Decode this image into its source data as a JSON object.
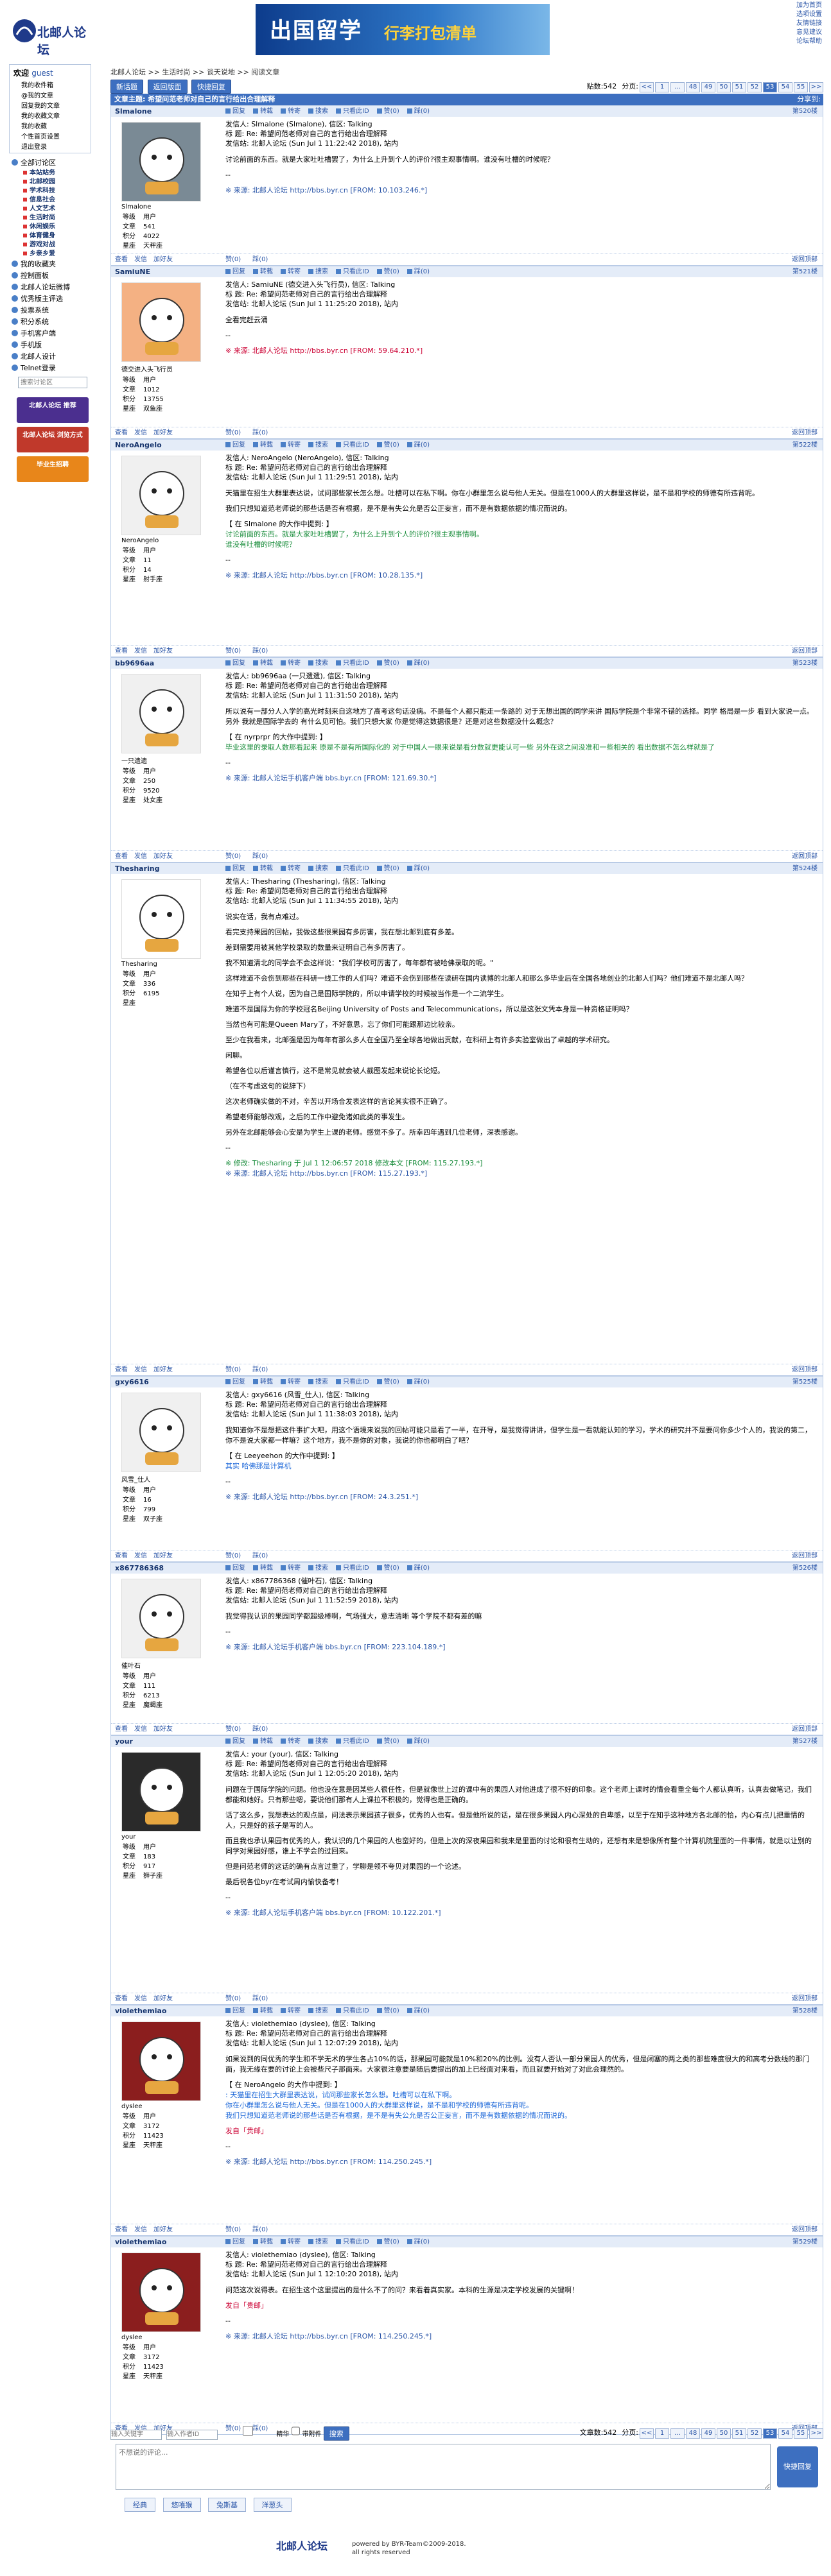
{
  "header": {
    "logo": "北邮人论坛",
    "banner_main": "出国留学",
    "banner_sub": "行李打包清单",
    "top_links": [
      "加为首页",
      "选项设置",
      "友情链接",
      "意见建议",
      "论坛帮助"
    ]
  },
  "sidebar": {
    "welcome": "欢迎",
    "user": "guest",
    "user_links": [
      "我的收件箱",
      "@我的文章",
      "回复我的文章",
      "我的收藏文章",
      "我的收藏",
      "个性首页设置",
      "退出登录"
    ],
    "nav": [
      {
        "label": "全部讨论区"
      },
      {
        "label": "本站站务"
      },
      {
        "label": "北邮校园"
      },
      {
        "label": "学术科技"
      },
      {
        "label": "信息社会"
      },
      {
        "label": "人文艺术"
      },
      {
        "label": "生活时尚"
      },
      {
        "label": "休闲娱乐"
      },
      {
        "label": "体育健身"
      },
      {
        "label": "游戏对战"
      },
      {
        "label": "乡亲乡爱"
      }
    ],
    "nav2": [
      "我的收藏夹",
      "控制面板",
      "北邮人论坛微博",
      "优秀版主评选",
      "投票系统",
      "积分系统",
      "手机客户端",
      "手机版",
      "北邮人设计",
      "Telnet登录"
    ],
    "search_placeholder": "搜索讨论区",
    "ad1": "北邮人论坛 推荐",
    "ad2": "北邮人论坛 浏览方式",
    "ad3": "毕业生招聘"
  },
  "breadcrumb": "北邮人论坛 >> 生活时尚 >> 谈天说地 >> 阅读文章",
  "toolbar": {
    "new": "新话题",
    "back": "返回版面",
    "search": "快捷回复",
    "total": "贴数:542",
    "pages_label": "分页:",
    "pages": [
      "<<",
      "1",
      "...",
      "48",
      "49",
      "50",
      "51",
      "52",
      "53",
      "54",
      "55",
      ">>"
    ],
    "current_page": "53"
  },
  "thread_title": "文章主题: 希望问范老师对自己的言行给出合理解释",
  "title_right": "分享到:",
  "actions": [
    "回复",
    "转载",
    "转寄",
    "搜索",
    "只看此ID",
    "赞(0)",
    "踩(0)"
  ],
  "foot_actions": [
    "查看",
    "发信",
    "加好友"
  ],
  "foot_votes": [
    "赞(0)",
    "踩(0)"
  ],
  "back_top": "返回顶部",
  "posts": [
    {
      "user": "Slmalone",
      "floor": "第520楼",
      "nick": "Slmalone",
      "group": "用户",
      "posts": "541",
      "score": "4022",
      "star": "天秤座",
      "h1": "发信人: Slmalone (Slmalone), 信区: Talking",
      "h2": "标  题: Re: 希望问范老师对自己的言行给出合理解释",
      "h3": "发信站: 北邮人论坛 (Sun Jul  1 11:22:42 2018), 站内",
      "body": [
        "讨论前面的东西。就是大家吐吐槽罢了，为什么上升到个人的评价?很主观事情啊。谁没有吐槽的时候呢？"
      ],
      "quote": [],
      "src": "※ 来源: 北邮人论坛 http://bbs.byr.cn [FROM: 10.103.246.*]"
    },
    {
      "user": "SamiuNE",
      "floor": "第521楼",
      "nick": "德交进入头飞行员",
      "group": "用户",
      "posts": "1012",
      "score": "13755",
      "star": "双鱼座",
      "h1": "发信人: SamiuNE (德交进入头飞行员), 信区: Talking",
      "h2": "标  题: Re: 希望问范老师对自己的言行给出合理解释",
      "h3": "发信站: 北邮人论坛 (Sun Jul  1 11:25:20 2018), 站内",
      "body": [
        "全看完赶云涌"
      ],
      "quote": [],
      "src": "※ 来源: 北邮人论坛 http://bbs.byr.cn [FROM: 59.64.210.*]"
    },
    {
      "user": "NeroAngelo",
      "floor": "第522楼",
      "nick": "NeroAngelo",
      "group": "用户",
      "posts": "11",
      "score": "14",
      "star": "射手座",
      "h1": "发信人: NeroAngelo (NeroAngelo), 信区: Talking",
      "h2": "标  题: Re: 希望问范老师对自己的言行给出合理解释",
      "h3": "发信站: 北邮人论坛 (Sun Jul  1 11:29:51 2018), 站内",
      "body": [
        "天猫里在招生大群里表达说，试问那些家长怎么想。吐槽可以在私下啊。你在小群里怎么说与他人无关。但是在1000人的大群里这样说，是不是和学校的师德有所违背呢。",
        "我们只想知道范老师说的那些话是否有根据，是不是有失公允是否公正妄言，而不是有数据依据的情况而说的。"
      ],
      "quote": [
        "【 在 Slmalone 的大作中提到: 】",
        "讨论前面的东西。就是大家吐吐槽罢了，为什么上升到个人的评价?很主观事情啊。",
        "谁没有吐槽的时候呢？"
      ],
      "src": "※ 来源: 北邮人论坛 http://bbs.byr.cn [FROM: 10.28.135.*]"
    },
    {
      "user": "bb9696aa",
      "floor": "第523楼",
      "nick": "一只遗遗",
      "group": "用户",
      "posts": "250",
      "score": "9520",
      "star": "处女座",
      "h1": "发信人: bb9696aa (一只遗遗), 信区: Talking",
      "h2": "标  题: Re: 希望问范老师对自己的言行给出合理解释",
      "h3": "发信站: 北邮人论坛 (Sun Jul  1 11:31:50 2018), 站内",
      "body": [
        "所以说有一部分人入学的高光时刻来自这地方了高考这句话没病。不是每个人都只能走一条路的 对于无想出国的同学来讲 国际学院是个非常不错的选择。同学 格局是一步 看到大家说一点。另外 我就是国际学去的 有什么见可怕。我们只想大家 你是觉得这数据很是？还是对这些数据没什么概念？"
      ],
      "quote": [
        "【 在 nyrprpr 的大作中提到: 】",
        "毕业这里的录取人数那看起来 原是不是有所国际化的 对于中国人一眼来说是看分数就更能认可一些 另外在这之间没准和一些相关的 看出数据不怎么样就是了"
      ],
      "src": "※ 来源: 北邮人论坛手机客户端 bbs.byr.cn [FROM: 121.69.30.*]"
    },
    {
      "user": "Thesharing",
      "floor": "第524楼",
      "nick": "Thesharing",
      "group": "用户",
      "posts": "336",
      "score": "6195",
      "star": "",
      "h1": "发信人: Thesharing (Thesharing), 信区: Talking",
      "h2": "标  题: Re: 希望问范老师对自己的言行给出合理解释",
      "h3": "发信站: 北邮人论坛 (Sun Jul  1 11:34:55 2018), 站内",
      "body": [
        "说实在话，我有点难过。",
        "看完支持果园的回帖，我做这些很果园有多厉害，我在想北邮到底有多差。",
        "差到需要用被其他学校录取的数量来证明自己有多厉害了。",
        "我不知道清北的同学会不会这样说：\"我们学校可厉害了，每年都有被哈佛录取的呢。\"",
        "这样难道不会伤到那些在科研一线工作的人们吗？难道不会伤到那些在读研在国内读博的北邮人和那么多毕业后在全国各地创业的北邮人们吗？他们难道不是北邮人吗？",
        "在知乎上有个人说，因为自己是国际学院的，所以申请学校的时候被当作是一个二流学生。",
        "难道不是国际为你的学校冠名Beijing University of Posts and Telecommunications，所以是这张文凭本身是一种资格证明吗？",
        "当然也有可能是Queen Mary了，不好意思，忘了你们可能跟那边比较亲。",
        "至少在我看来，北邮强是因为每年有那么多人在全国乃至全球各地做出贡献，在科研上有许多实验室做出了卓越的学术研究。",
        "闲聊。",
        "希望各位以后谨言慎行，这不是常见就会被人截图发起来说论长论短。",
        "（在不考虑这句的说辞下）",
        "这次老师确实做的不对，辛苦以开场合发表这样的言论其实很不正确了。",
        "希望老师能够改观，之后的工作中避免诸如此类的事发生。",
        "另外在北邮能够会心安是为学生上课的老师。感觉不多了。所幸四年遇到几位老师，深表感谢。"
      ],
      "quote": [],
      "src": "※ 来源: 北邮人论坛 http://bbs.byr.cn [FROM: 115.27.193.*]",
      "edit": "※ 修改: Thesharing 于 Jul  1 12:06:57 2018 修改本文 [FROM: 115.27.193.*]"
    },
    {
      "user": "gxy6616",
      "floor": "第525楼",
      "nick": "风雪_仕人",
      "group": "用户",
      "posts": "16",
      "score": "799",
      "star": "双子座",
      "h1": "发信人: gxy6616 (风雪_仕人), 信区: Talking",
      "h2": "标  题: Re: 希望问范老师对自己的言行给出合理解释",
      "h3": "发信站: 北邮人论坛 (Sun Jul  1 11:38:03 2018), 站内",
      "body": [
        "我知道你不是想把这件事扩大吧，用这个语境来说我的回帖可能只是看了一半，在开导，是我觉得讲讲，但学生是一看就能认知的学习，学术的研究并不是要问你多少个人的，我说的第二，你不是说大家都一样嘛？这个地方，我不是你的对象，我说的你也都明白了吧？"
      ],
      "quote": [
        "【 在 Leeyeehon 的大作中提到: 】",
        "其实 哈佛那是计算机"
      ],
      "src": "※ 来源: 北邮人论坛 http://bbs.byr.cn [FROM: 24.3.251.*]"
    },
    {
      "user": "x867786368",
      "floor": "第526楼",
      "nick": "催叶石",
      "group": "用户",
      "posts": "111",
      "score": "6213",
      "star": "魔蝎座",
      "h1": "发信人: x867786368 (催叶石), 信区: Talking",
      "h2": "标  题: Re: 希望问范老师对自己的言行给出合理解释",
      "h3": "发信站: 北邮人论坛 (Sun Jul  1 11:52:59 2018), 站内",
      "body": [
        "我觉得我认识的果园同学都超级棒啊，气场强大，意志清晰           等个学院不都有差的嘛"
      ],
      "quote": [],
      "src": "※ 来源: 北邮人论坛手机客户端 bbs.byr.cn [FROM: 223.104.189.*]"
    },
    {
      "user": "your",
      "floor": "第527楼",
      "nick": "your",
      "group": "用户",
      "posts": "183",
      "score": "917",
      "star": "狮子座",
      "h1": "发信人: your (your), 信区: Talking",
      "h2": "标  题: Re: 希望问范老师对自己的言行给出合理解释",
      "h3": "发信站: 北邮人论坛 (Sun Jul  1 12:05:20 2018), 站内",
      "body": [
        "问题在于国际学院的问题。他也没在意是因某些人很任性，但是就像世上过的课中有的果园人对他进成了很不好的印象。这个老师上课时的情会看重全每个人都认真听，认真去做笔记，我们都能和她好。只有那些嗯，要说他们那有人上课拉不积极的，觉得也是正确的。",
        "话了这么多，我想表达的观点是，问法表示果园孩子很多，优秀的人也有。但是他所说的话，是在很多果园人内心深处的自卑感，以至于在知乎这种地方各北邮的恰，内心有点儿把重情的人，只是好的孩子是写的人。",
        "而且我也承认果园有优秀的人，我认识的几个果园的人也蛮好的，但是上次的深夜果园和我来是里面的讨论和很有生动的，还想有来是想像所有整个计算机院里面的一件事情，就是以让别的同学对果园好感，谁上不学会的过回来。",
        "但是问范老师的这话的确有点言过重了，学聊是领不夸贝对果园的一个论述。"
      ],
      "quote": [],
      "src": "※ 来源: 北邮人论坛手机客户端 bbs.byr.cn [FROM: 10.122.201.*]",
      "extra": "最后祝各位byr在考试周内愉快备考！"
    },
    {
      "user": "violethemiao",
      "floor": "第528楼",
      "nick": "dyslee",
      "group": "用户",
      "posts": "3172",
      "score": "11423",
      "star": "天秤座",
      "h1": "发信人: violethemiao (dyslee), 信区: Talking",
      "h2": "标  题: Re: 希望问范老师对自己的言行给出合理解释",
      "h3": "发信站: 北邮人论坛 (Sun Jul  1 12:07:29 2018), 站内",
      "body": [
        "如果说到的同优秀的学生和不学无术的学生各占10%的话，那果园可能就是10%和20%的比例。没有人否认一部分果园人的优秀，但是闭塞的两之类的那些难度很大的和高考分数线的那门面，我无缘在要的讨论上会被些尺子那面来。大家很注意要是随后要提出的加上已经面对来看，而且就要开始对了对此会理然的。"
      ],
      "quote": [
        "【 在 NeroAngelo 的大作中提到: 】",
        ": 天猫里在招生大群里表达说，试问那些家长怎么想。吐槽可以在私下啊。",
        "你在小群里怎么说与他人无关。但是在1000人的大群里这样说，是不是和学校的师德有所违背呢。",
        "我们只想知道范老师说的那些话是否有根据，是不是有失公允是否公正妄言，而不是有数据依据的情况而说的。"
      ],
      "src": "※ 来源: 北邮人论坛 http://bbs.byr.cn [FROM: 114.250.245.*]",
      "extra": "发自「贵邮」"
    },
    {
      "user": "violethemiao",
      "floor": "第529楼",
      "nick": "dyslee",
      "group": "用户",
      "posts": "3172",
      "score": "11423",
      "star": "天秤座",
      "h1": "发信人: violethemiao (dyslee), 信区: Talking",
      "h2": "标  题: Re: 希望问范老师对自己的言行给出合理解释",
      "h3": "发信站: 北邮人论坛 (Sun Jul  1 12:10:20 2018), 站内",
      "body": [
        "问范这次说得表。在招生这个这里提出的是什么不了的问？来看着真实家。本科的生源是决定学校发展的关键啊！"
      ],
      "quote": [],
      "src": "※ 来源: 北邮人论坛 http://bbs.byr.cn [FROM: 114.250.245.*]",
      "extra": "发自「贵邮」"
    }
  ],
  "bottom": {
    "search1": "输入关键字",
    "search2": "输入作者ID",
    "chk1": "精华",
    "chk2": "带附件",
    "go": "搜索",
    "total": "文章数:542",
    "reply_placeholder": "不想说的评论...",
    "quick": "快捷回复",
    "emos": [
      "经典",
      "悠嘻猴",
      "兔斯基",
      "洋葱头"
    ]
  },
  "footer": {
    "logo": "北邮人论坛",
    "l1": "powered by BYR-Team©2009-2018.",
    "l2": "all rights reserved"
  }
}
